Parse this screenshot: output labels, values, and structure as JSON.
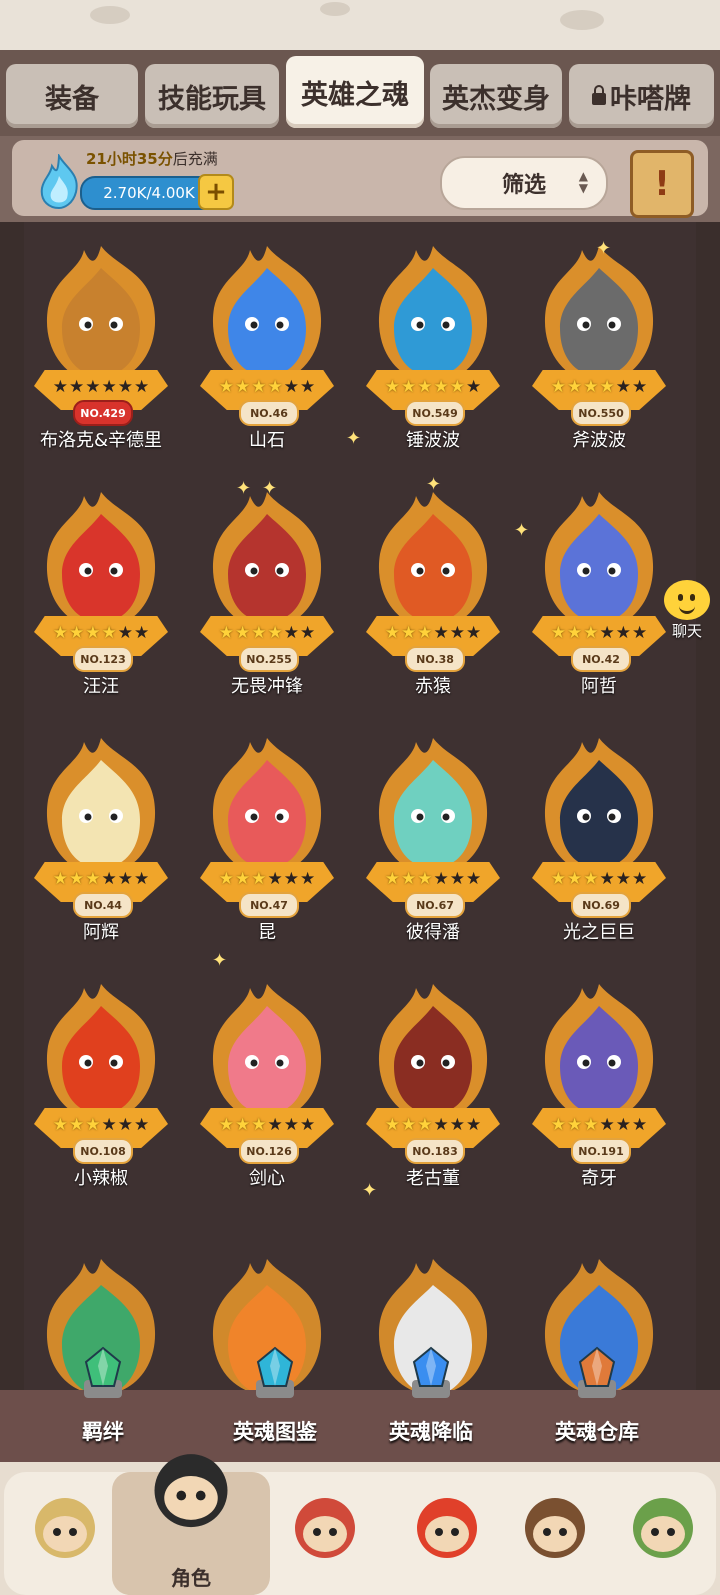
{
  "tabs": [
    {
      "label": "装备",
      "active": false
    },
    {
      "label": "技能玩具",
      "active": false
    },
    {
      "label": "英雄之魂",
      "active": true
    },
    {
      "label": "英杰变身",
      "active": false
    },
    {
      "label": "咔嗒牌",
      "active": false,
      "locked": true
    }
  ],
  "energy": {
    "refill_time": "21小时35分",
    "refill_suffix": "后充满",
    "value": "2.70K/4.00K",
    "fill_fraction": 0.675,
    "plus": "+"
  },
  "filter": {
    "label": "筛选"
  },
  "info_button": {
    "glyph": "!"
  },
  "heroes": [
    {
      "no": "NO.429",
      "name": "布洛克&辛德里",
      "stars": 0,
      "color": "#c8812e",
      "red": true
    },
    {
      "no": "NO.46",
      "name": "山石",
      "stars": 4,
      "color": "#3f86e8",
      "red": false
    },
    {
      "no": "NO.549",
      "name": "锤波波",
      "stars": 5,
      "color": "#2f9ad6",
      "red": false
    },
    {
      "no": "NO.550",
      "name": "斧波波",
      "stars": 4,
      "color": "#6b6b6b",
      "red": false
    },
    {
      "no": "NO.123",
      "name": "汪汪",
      "stars": 4,
      "color": "#d9352b",
      "red": false
    },
    {
      "no": "NO.255",
      "name": "无畏冲锋",
      "stars": 4,
      "color": "#b5342e",
      "red": false
    },
    {
      "no": "NO.38",
      "name": "赤猿",
      "stars": 3,
      "color": "#e05a24",
      "red": false
    },
    {
      "no": "NO.42",
      "name": "阿哲",
      "stars": 3,
      "color": "#5b73d8",
      "red": false
    },
    {
      "no": "NO.44",
      "name": "阿辉",
      "stars": 3,
      "color": "#f3e4b2",
      "red": false
    },
    {
      "no": "NO.47",
      "name": "昆",
      "stars": 3,
      "color": "#e85a5a",
      "red": false
    },
    {
      "no": "NO.67",
      "name": "彼得潘",
      "stars": 3,
      "color": "#6fd0c0",
      "red": false
    },
    {
      "no": "NO.69",
      "name": "光之巨巨",
      "stars": 3,
      "color": "#26324a",
      "red": false
    },
    {
      "no": "NO.108",
      "name": "小辣椒",
      "stars": 3,
      "color": "#e0401e",
      "red": false
    },
    {
      "no": "NO.126",
      "name": "剑心",
      "stars": 3,
      "color": "#f07a8a",
      "red": false
    },
    {
      "no": "NO.183",
      "name": "老古董",
      "stars": 3,
      "color": "#8a2d22",
      "red": false
    },
    {
      "no": "NO.191",
      "name": "奇牙",
      "stars": 3,
      "color": "#6a5ab8",
      "red": false
    }
  ],
  "partial_heroes": [
    {
      "color": "#3fa86a"
    },
    {
      "color": "#f0842a"
    },
    {
      "color": "#e8e8e8"
    },
    {
      "color": "#3a7ad8"
    }
  ],
  "chat": {
    "label": "聊天"
  },
  "bottom_menu": [
    {
      "label": "羁绊",
      "gem_color": "#3fbf7a"
    },
    {
      "label": "英魂图鉴",
      "gem_color": "#2fb5d8"
    },
    {
      "label": "英魂降临",
      "gem_color": "#3a8ef0"
    },
    {
      "label": "英魂仓库",
      "gem_color": "#e07a3a"
    }
  ],
  "nav": [
    {
      "label": "",
      "color": "#d8b86a",
      "active": false
    },
    {
      "label": "角色",
      "color": "#2b2b2b",
      "active": true
    },
    {
      "label": "",
      "color": "#d04a3a",
      "active": false
    },
    {
      "label": "",
      "color": "#e0402a",
      "active": false
    },
    {
      "label": "",
      "color": "#7a5030",
      "active": false
    },
    {
      "label": "",
      "color": "#6ba04a",
      "active": false
    }
  ]
}
